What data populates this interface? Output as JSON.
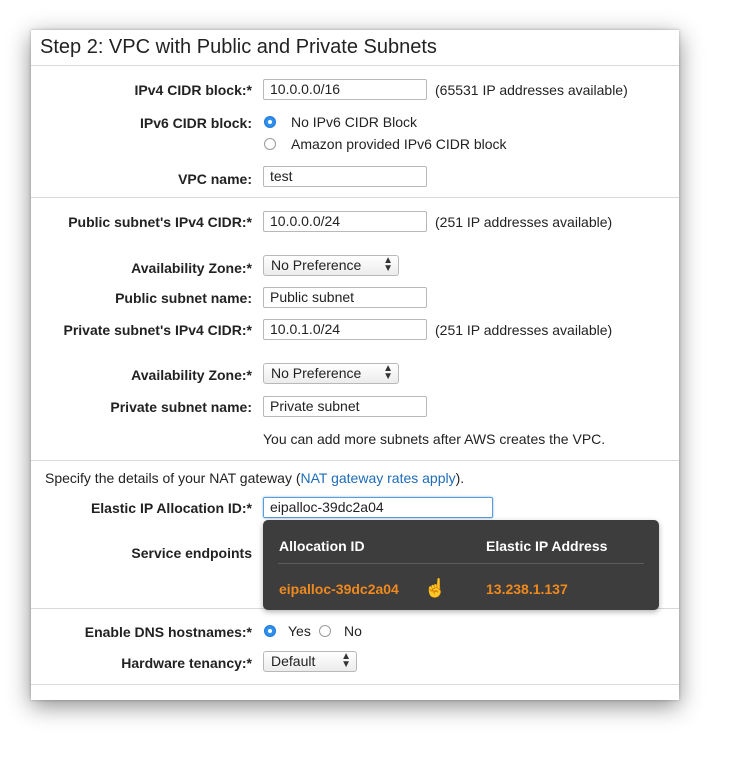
{
  "title": "Step 2: VPC with Public and Private Subnets",
  "ipv4_cidr": {
    "label": "IPv4 CIDR block:*",
    "value": "10.0.0.0/16",
    "note": "(65531 IP addresses available)"
  },
  "ipv6_cidr": {
    "label": "IPv6 CIDR block:",
    "options": [
      "No IPv6 CIDR Block",
      "Amazon provided IPv6 CIDR block"
    ],
    "selected": "No IPv6 CIDR Block"
  },
  "vpc_name": {
    "label": "VPC name:",
    "value": "test"
  },
  "public_cidr": {
    "label": "Public subnet's IPv4 CIDR:*",
    "value": "10.0.0.0/24",
    "note": "(251 IP addresses available)"
  },
  "public_az": {
    "label": "Availability Zone:*",
    "value": "No Preference"
  },
  "public_name": {
    "label": "Public subnet name:",
    "value": "Public subnet"
  },
  "private_cidr": {
    "label": "Private subnet's IPv4 CIDR:*",
    "value": "10.0.1.0/24",
    "note": "(251 IP addresses available)"
  },
  "private_az": {
    "label": "Availability Zone:*",
    "value": "No Preference"
  },
  "private_name": {
    "label": "Private subnet name:",
    "value": "Private subnet"
  },
  "subnet_note": "You can add more subnets after AWS creates the VPC.",
  "nat": {
    "prefix": "Specify the details of your NAT gateway (",
    "link": "NAT gateway rates apply",
    "suffix": ")."
  },
  "eip": {
    "label": "Elastic IP Allocation ID:*",
    "value": "eipalloc-39dc2a04"
  },
  "service_endpoints": {
    "label": "Service endpoints"
  },
  "popup": {
    "col1_header": "Allocation ID",
    "col2_header": "Elastic IP Address",
    "rows": [
      {
        "allocation_id": "eipalloc-39dc2a04",
        "address": "13.238.1.137"
      }
    ]
  },
  "dns_hostnames": {
    "label": "Enable DNS hostnames:*",
    "options": [
      "Yes",
      "No"
    ],
    "selected": "Yes"
  },
  "tenancy": {
    "label": "Hardware tenancy:*",
    "value": "Default"
  },
  "icons": {
    "select_arrow": "up-down-arrows-icon",
    "pointer": "hand-pointer-icon"
  },
  "colors": {
    "accent": "#2f8ff0",
    "link": "#1e6bb8",
    "popup_bg": "#3d3d3d",
    "popup_highlight": "#f0891d"
  }
}
